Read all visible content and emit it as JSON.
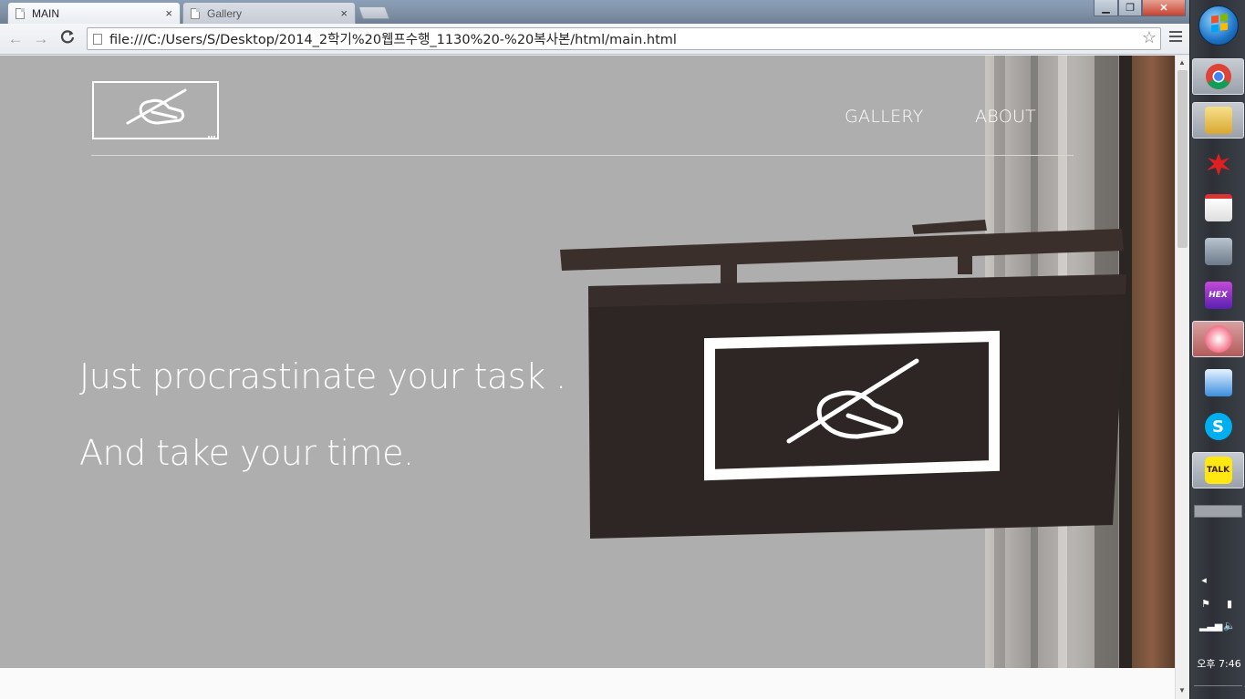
{
  "browser": {
    "tabs": [
      {
        "label": "MAIN",
        "close": "×"
      },
      {
        "label": "Gallery",
        "close": "×"
      }
    ],
    "window_controls": {
      "minimize": "▁",
      "restore": "❐",
      "close": "✕"
    },
    "nav": {
      "back": "←",
      "forward": "→",
      "reload": "C"
    },
    "address": "file:///C:/Users/S/Desktop/2014_2학기%20웹프수행_1130%20-%20복사본/html/main.html",
    "star": "☆"
  },
  "site": {
    "nav": [
      "GALLERY",
      "ABOUT"
    ],
    "taglines": [
      "Just procrastinate your task .",
      "And take your time."
    ]
  },
  "taskbar": {
    "apps": [
      {
        "name": "chrome-icon",
        "label": ""
      },
      {
        "name": "file-explorer-icon",
        "label": ""
      },
      {
        "name": "paint-splat-icon",
        "label": ""
      },
      {
        "name": "notepad-icon",
        "label": ""
      },
      {
        "name": "archive-icon",
        "label": ""
      },
      {
        "name": "hex-editor-icon",
        "label": "HEX"
      },
      {
        "name": "snipping-tool-icon",
        "label": ""
      },
      {
        "name": "editor-icon",
        "label": ""
      },
      {
        "name": "skype-icon",
        "label": "S"
      },
      {
        "name": "kakaotalk-icon",
        "label": "TALK"
      }
    ],
    "clock": "오후 7:46"
  },
  "colors": {
    "hero_bg": "#aeaeae",
    "sign_board": "#2e2624",
    "accent": "#ffffff"
  }
}
